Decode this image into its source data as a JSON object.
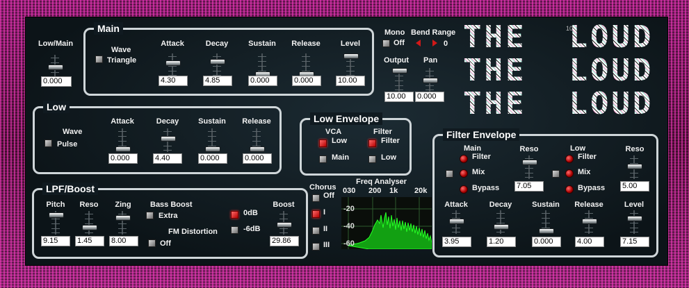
{
  "colors": {
    "accent_red": "#d01818",
    "frame": "#8a1f6e",
    "panel": "#101a20",
    "analyser_green": "#25ff25"
  },
  "logo": {
    "lines": [
      "THE  LOUD",
      "THE  LOUD",
      "THE  LOUD"
    ],
    "small_number": "10"
  },
  "low_main": {
    "label": "Low/Main",
    "value": "0.000"
  },
  "main": {
    "title": "Main",
    "wave_label": "Wave",
    "wave_value": "Triangle",
    "attack_label": "Attack",
    "attack_value": "4.30",
    "decay_label": "Decay",
    "decay_value": "4.85",
    "sustain_label": "Sustain",
    "sustain_value": "0.000",
    "release_label": "Release",
    "release_value": "0.000",
    "level_label": "Level",
    "level_value": "10.00"
  },
  "mono": {
    "label": "Mono",
    "value": "Off"
  },
  "bend_range": {
    "label": "Bend Range",
    "value": "0"
  },
  "output": {
    "label": "Output",
    "value": "10.00"
  },
  "pan": {
    "label": "Pan",
    "value": "0.000"
  },
  "low": {
    "title": "Low",
    "wave_label": "Wave",
    "wave_value": "Pulse",
    "attack_label": "Attack",
    "attack_value": "0.000",
    "decay_label": "Decay",
    "decay_value": "4.40",
    "sustain_label": "Sustain",
    "sustain_value": "0.000",
    "release_label": "Release",
    "release_value": "0.000"
  },
  "low_envelope": {
    "title": "Low Envelope",
    "vca_label": "VCA",
    "filter_label": "Filter",
    "vca_low": "Low",
    "vca_main": "Main",
    "filter_filter": "Filter",
    "filter_low": "Low"
  },
  "filter_envelope": {
    "title": "Filter Envelope",
    "main_label": "Main",
    "main_filter": "Filter",
    "main_mix": "Mix",
    "main_bypass": "Bypass",
    "reso_label": "Reso",
    "reso_value": "7.05",
    "low_label": "Low",
    "low_filter": "Filter",
    "low_mix": "Mix",
    "low_bypass": "Bypass",
    "reso2_label": "Reso",
    "reso2_value": "5.00",
    "attack_label": "Attack",
    "attack_value": "3.95",
    "decay_label": "Decay",
    "decay_value": "1.20",
    "sustain_label": "Sustain",
    "sustain_value": "0.000",
    "release_label": "Release",
    "release_value": "4.00",
    "level_label": "Level",
    "level_value": "7.15"
  },
  "lpf_boost": {
    "title": "LPF/Boost",
    "pitch_label": "Pitch",
    "pitch_value": "9.15",
    "reso_label": "Reso",
    "reso_value": "1.45",
    "zing_label": "Zing",
    "zing_value": "8.00",
    "bass_boost_label": "Bass Boost",
    "bass_boost_value": "Extra",
    "fm_label": "FM Distortion",
    "fm_value": "Off",
    "db0": "0dB",
    "db6": "-6dB",
    "boost_label": "Boost",
    "boost_value": "29.86"
  },
  "chorus": {
    "label": "Chorus",
    "options": [
      "Off",
      "I",
      "II",
      "III"
    ]
  },
  "freq_analyser": {
    "title": "Freq Analyser",
    "freq_ticks": [
      "030",
      "200",
      "1k",
      "20k"
    ],
    "db_ticks": [
      "-20",
      "-40",
      "-60"
    ]
  }
}
